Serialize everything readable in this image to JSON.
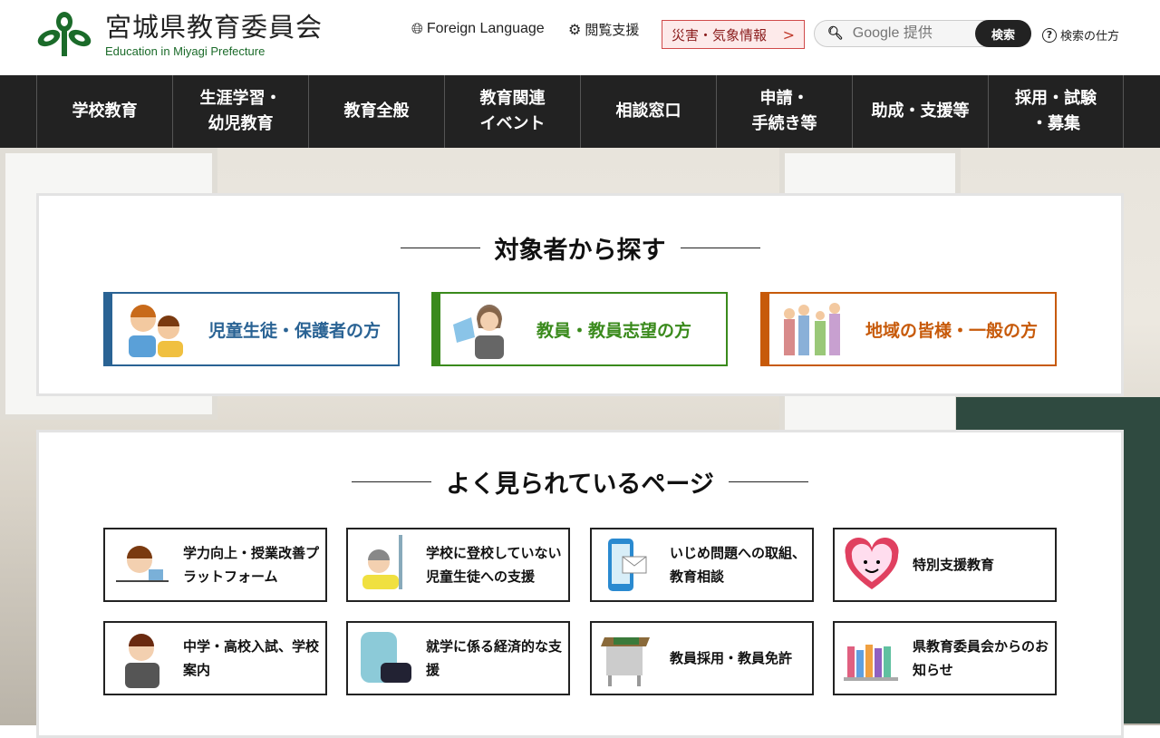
{
  "header": {
    "title": "宮城県教育委員会",
    "subtitle": "Education in Miyagi Prefecture",
    "foreign_language": "Foreign Language",
    "accessibility": "閲覧支援",
    "disaster": "災害・気象情報",
    "search_placeholder": "Google 提供",
    "search_button": "検索",
    "search_help": "検索の仕方"
  },
  "nav": [
    "学校教育",
    "生涯学習・\n幼児教育",
    "教育全般",
    "教育関連\nイベント",
    "相談窓口",
    "申請・\n手続き等",
    "助成・支援等",
    "採用・試験\n・募集"
  ],
  "target": {
    "title": "対象者から探す",
    "cards": [
      {
        "label": "児童生徒・保護者の方",
        "color": "#2a6394"
      },
      {
        "label": "教員・教員志望の方",
        "color": "#3a8a1c"
      },
      {
        "label": "地域の皆様・一般の方",
        "color": "#c75a0a"
      }
    ]
  },
  "popular": {
    "title": "よく見られているページ",
    "cards": [
      "学力向上・授業改善プラットフォーム",
      "学校に登校していない児童生徒への支援",
      "いじめ問題への取組、教育相談",
      "特別支援教育",
      "中学・高校入試、学校案内",
      "就学に係る経済的な支援",
      "教員採用・教員免許",
      "県教育委員会からのお知らせ"
    ]
  }
}
